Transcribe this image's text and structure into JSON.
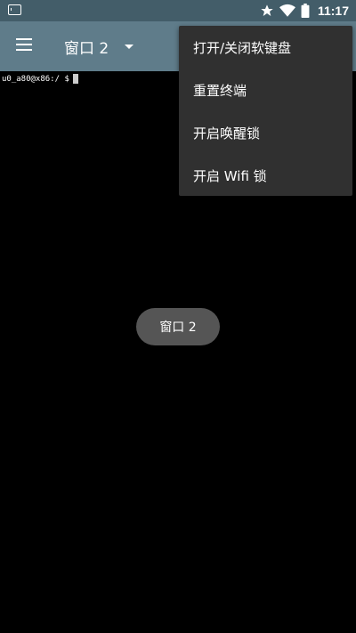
{
  "status_bar": {
    "time": "11:17",
    "icons": [
      "terminal-notification-icon",
      "star-icon",
      "wifi-icon",
      "battery-icon"
    ]
  },
  "app_bar": {
    "menu_icon": "hamburger-menu-icon",
    "window_title": "窗口 2",
    "dropdown_icon": "dropdown-arrow-icon",
    "background": "#5f7c8a"
  },
  "terminal": {
    "prompt": "u0_a80@x86:/ $",
    "background": "#000000"
  },
  "toast": {
    "text": "窗口 2"
  },
  "overflow_menu": {
    "items": [
      {
        "label": "打开/关闭软键盘"
      },
      {
        "label": "重置终端"
      },
      {
        "label": "开启唤醒锁"
      },
      {
        "label": "开启 Wifi 锁"
      }
    ]
  }
}
